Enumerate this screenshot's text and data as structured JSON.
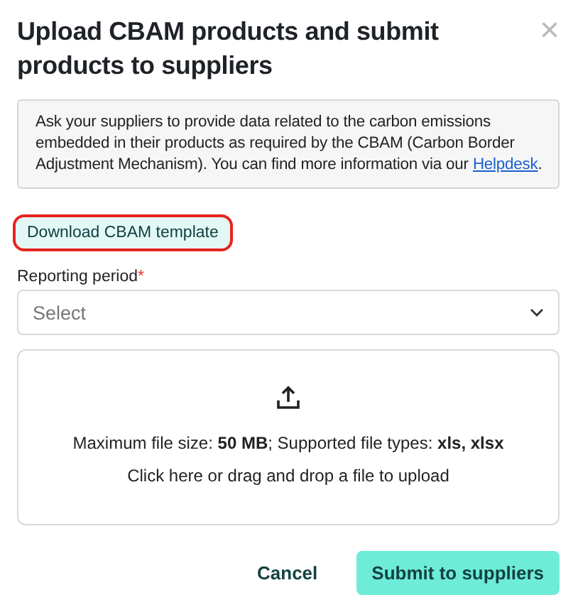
{
  "dialog": {
    "title": "Upload CBAM products and submit products to suppliers",
    "close": "×",
    "info": {
      "text": "Ask your suppliers to provide data related to the carbon emissions embedded in their products as required by the CBAM (Carbon Border Adjustment Mechanism). You can find more information via our ",
      "link": "Helpdesk",
      "after": "."
    },
    "download_button": {
      "label": "Download CBAM template",
      "highlighted": true
    },
    "reporting_period": {
      "label": "Reporting period",
      "required": "*",
      "placeholder": "Select"
    },
    "upload": {
      "limits": "Maximum file size: **50 MB**; Supported file types: **xls, xlsx**",
      "hint": "Click here or drag and drop a file to upload"
    },
    "buttons": [
      {
        "kind": "text",
        "label": "Cancel"
      },
      {
        "kind": "primary",
        "label": "Submit to suppliers"
      }
    ]
  }
}
